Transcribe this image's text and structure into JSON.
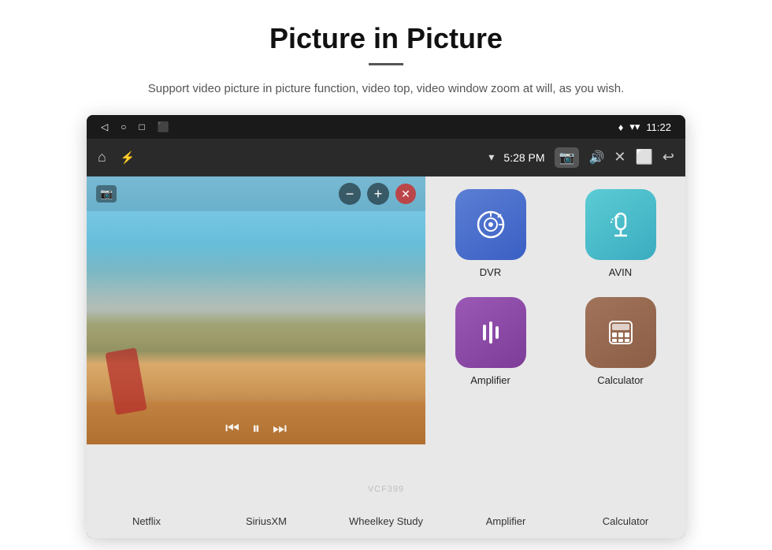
{
  "page": {
    "title": "Picture in Picture",
    "subtitle": "Support video picture in picture function, video top, video window zoom at will, as you wish.",
    "divider_color": "#555"
  },
  "statusbar": {
    "left_icons": [
      "◁",
      "○",
      "□",
      "⬛"
    ],
    "right_icons": [
      "♦",
      "▾"
    ],
    "time": "11:22"
  },
  "navbar": {
    "home_icon": "⌂",
    "usb_icon": "⚡",
    "wifi_icon": "▾",
    "time": "5:28 PM",
    "camera_icon": "📷",
    "volume_icon": "🔊",
    "close_icon": "✕",
    "pip_icon": "⬜",
    "back_icon": "↩"
  },
  "pip": {
    "cam_icon": "📷",
    "minus_label": "−",
    "plus_label": "+",
    "close_label": "✕",
    "prev_label": "⏮",
    "play_label": "⏸",
    "next_label": "⏭"
  },
  "apps": {
    "top_row": [
      {
        "color": "green",
        "label": ""
      },
      {
        "color": "red",
        "label": ""
      },
      {
        "color": "purple",
        "label": ""
      }
    ],
    "grid": [
      {
        "id": "dvr",
        "label": "DVR",
        "color": "dvr",
        "icon_symbol": "◎"
      },
      {
        "id": "avin",
        "label": "AVIN",
        "color": "avin",
        "icon_symbol": "🔌"
      },
      {
        "id": "amplifier",
        "label": "Amplifier",
        "color": "amplifier",
        "icon_symbol": "𝌭"
      },
      {
        "id": "calculator",
        "label": "Calculator",
        "color": "calculator",
        "icon_symbol": "⊞"
      }
    ]
  },
  "bottom_labels": [
    "Netflix",
    "SiriusXM",
    "Wheelkey Study",
    "Amplifier",
    "Calculator"
  ],
  "watermark": "VCF399"
}
